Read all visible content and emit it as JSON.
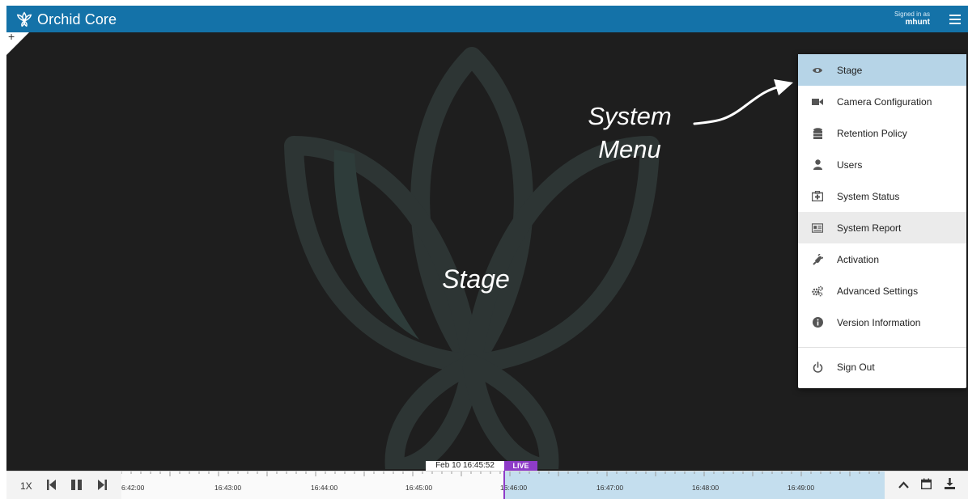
{
  "app": {
    "brand_name": "Orchid Core",
    "brand_color": "#1472a8",
    "signed_in_label": "Signed in as",
    "username": "mhunt",
    "menu_icon": "hamburger-icon"
  },
  "stage": {
    "label": "Stage",
    "annotation_system_menu": "System\nMenu"
  },
  "menu": {
    "items": [
      {
        "label": "Stage",
        "icon": "eye-icon",
        "state": "active"
      },
      {
        "label": "Camera Configuration",
        "icon": "video-camera-icon"
      },
      {
        "label": "Retention Policy",
        "icon": "database-icon"
      },
      {
        "label": "Users",
        "icon": "user-icon"
      },
      {
        "label": "System Status",
        "icon": "medkit-icon"
      },
      {
        "label": "System Report",
        "icon": "report-icon",
        "state": "hover"
      },
      {
        "label": "Activation",
        "icon": "plug-icon"
      },
      {
        "label": "Advanced Settings",
        "icon": "gears-icon"
      },
      {
        "label": "Version Information",
        "icon": "info-icon"
      },
      {
        "label": "Sign Out",
        "icon": "power-icon"
      }
    ],
    "active_color": "#b6d4e7"
  },
  "timeline": {
    "speed": "1X",
    "current_time": "Feb 10 16:45:52",
    "live_label": "LIVE",
    "live_color": "#8e3cc8",
    "tick_labels": [
      "6:42:00",
      "16:43:00",
      "16:44:00",
      "16:45:00",
      "16:46:00",
      "16:47:00",
      "16:48:00",
      "16:49:00"
    ]
  }
}
